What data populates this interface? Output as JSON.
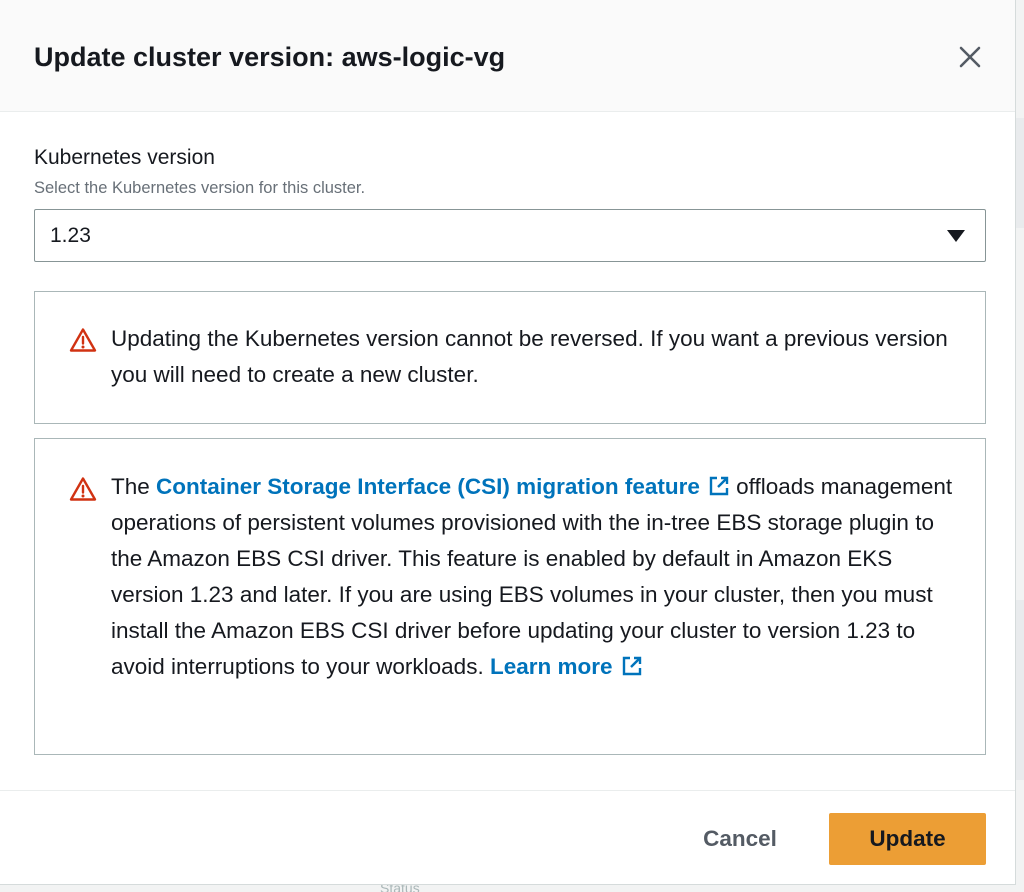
{
  "modal": {
    "title": "Update cluster version: aws-logic-vg",
    "close_icon": "close-icon"
  },
  "field": {
    "label": "Kubernetes version",
    "description": "Select the Kubernetes version for this cluster.",
    "selected_value": "1.23",
    "caret_icon": "caret-down-icon"
  },
  "alerts": [
    {
      "icon": "warning-icon",
      "text": "Updating the Kubernetes version cannot be reversed. If you want a previous version you will need to create a new cluster."
    },
    {
      "icon": "warning-icon",
      "text_before": "The ",
      "link_label": "Container Storage Interface (CSI) migration feature",
      "link_icon": "external-link-icon",
      "text_after": " offloads management operations of persistent volumes provisioned with the in-tree EBS storage plugin to the Amazon EBS CSI driver. This feature is enabled by default in Amazon EKS version 1.23 and later. If you are using EBS volumes in your cluster, then you must install the Amazon EBS CSI driver before updating your cluster to version 1.23 to avoid interruptions to your workloads. ",
      "learn_more_label": "Learn more",
      "learn_more_icon": "external-link-icon"
    }
  ],
  "footer": {
    "cancel_label": "Cancel",
    "update_label": "Update"
  },
  "background": {
    "partial_text": "Status"
  },
  "colors": {
    "primary_button": "#ec9e35",
    "link": "#0073bb",
    "warning": "#d13212"
  }
}
